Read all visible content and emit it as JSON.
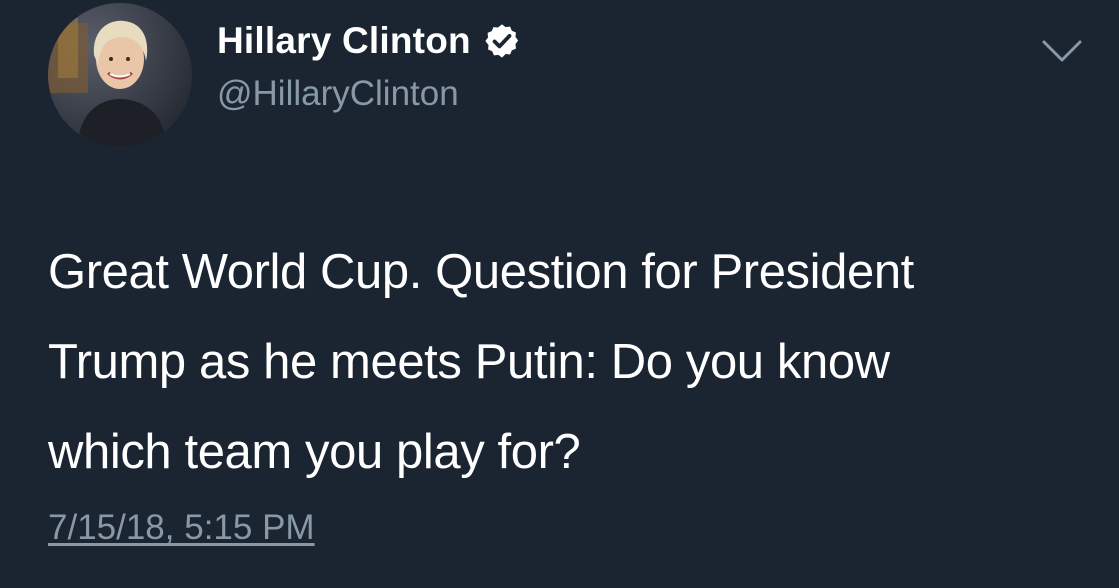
{
  "author": {
    "display_name": "Hillary Clinton",
    "handle": "@HillaryClinton",
    "verified": true,
    "avatar_icon": "profile-photo",
    "verified_icon": "verified-badge-icon"
  },
  "tweet": {
    "text_lines": [
      "Great World Cup. Question for President",
      "Trump as he meets Putin: Do you know",
      "which team you play for?"
    ],
    "timestamp": "7/15/18, 5:15 PM"
  },
  "menu": {
    "icon": "chevron-down-icon"
  },
  "colors": {
    "background": "#1b2431",
    "primary_text": "#ffffff",
    "secondary_text": "#8899a6"
  }
}
